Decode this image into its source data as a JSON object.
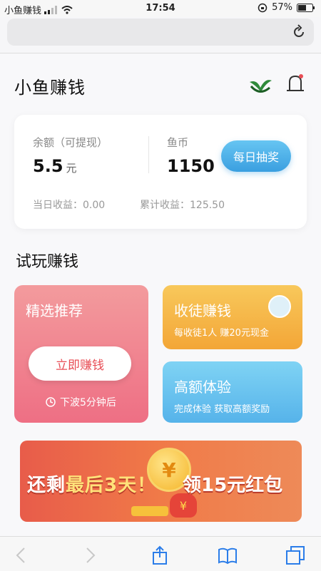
{
  "status_bar": {
    "carrier": "小鱼赚钱",
    "time": "17:54",
    "battery": "57%"
  },
  "header": {
    "title": "小鱼赚钱"
  },
  "balance_card": {
    "balance_label": "余额（可提现）",
    "balance_value": "5.5",
    "balance_unit": "元",
    "coin_label": "鱼币",
    "coin_value": "1150",
    "lottery_button": "每日抽奖",
    "today_income": "当日收益：0.00",
    "total_income": "累计收益：125.50"
  },
  "section_title": "试玩赚钱",
  "tiles": {
    "recommend": {
      "title": "精选推荐",
      "button": "立即赚钱",
      "next_wave": "下波5分钟后"
    },
    "apprentice": {
      "title": "收徒赚钱",
      "subtitle": "每收徒1人 赚20元现金"
    },
    "high_value": {
      "title": "高额体验",
      "subtitle": "完成体验 获取高额奖励"
    }
  },
  "banner": {
    "text_left_a": "还剩",
    "text_left_b": "最后3天！",
    "text_right": "领15元红包",
    "coin_symbol": "¥",
    "bag_symbol": "¥"
  },
  "colors": {
    "accent_blue": "#3a9fe0",
    "tile_pink": "#ee6f84",
    "tile_orange": "#f3a637",
    "tile_blue": "#56b3ea",
    "banner_red": "#e85c4a"
  }
}
